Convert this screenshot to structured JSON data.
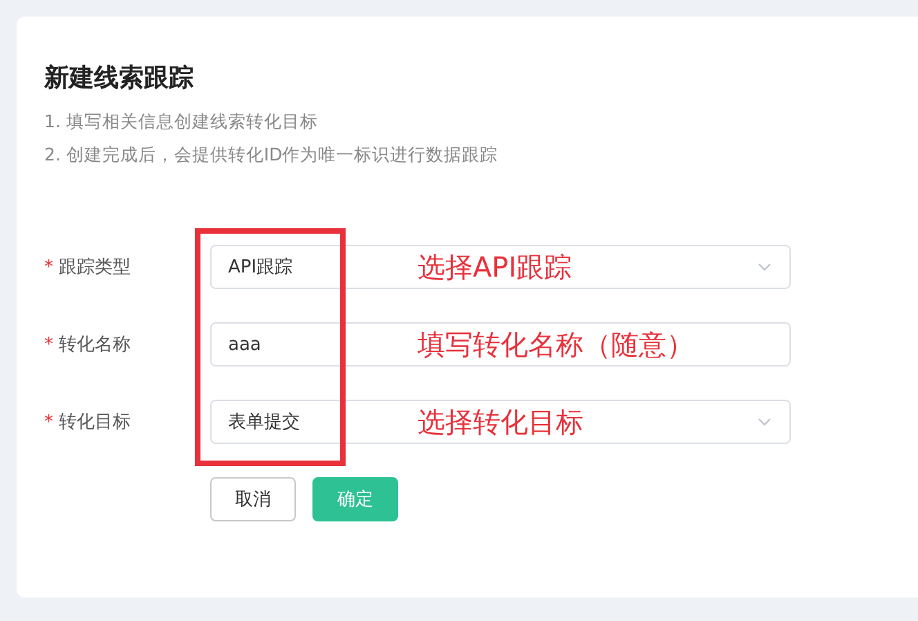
{
  "title": "新建线索跟踪",
  "notes": [
    "1. 填写相关信息创建线索转化目标",
    "2. 创建完成后，会提供转化ID作为唯一标识进行数据跟踪"
  ],
  "form": [
    {
      "mark": "*",
      "label": "跟踪类型",
      "kind": "select",
      "value": "API跟踪"
    },
    {
      "mark": "*",
      "label": "转化名称",
      "kind": "input",
      "value": "aaa"
    },
    {
      "mark": "*",
      "label": "转化目标",
      "kind": "select",
      "value": "表单提交"
    }
  ],
  "buttons": [
    {
      "label": "取消",
      "kind": "default"
    },
    {
      "label": "确定",
      "kind": "primary"
    }
  ],
  "annotations": [
    "选择API跟踪",
    "填写转化名称（随意）",
    "选择转化目标"
  ]
}
